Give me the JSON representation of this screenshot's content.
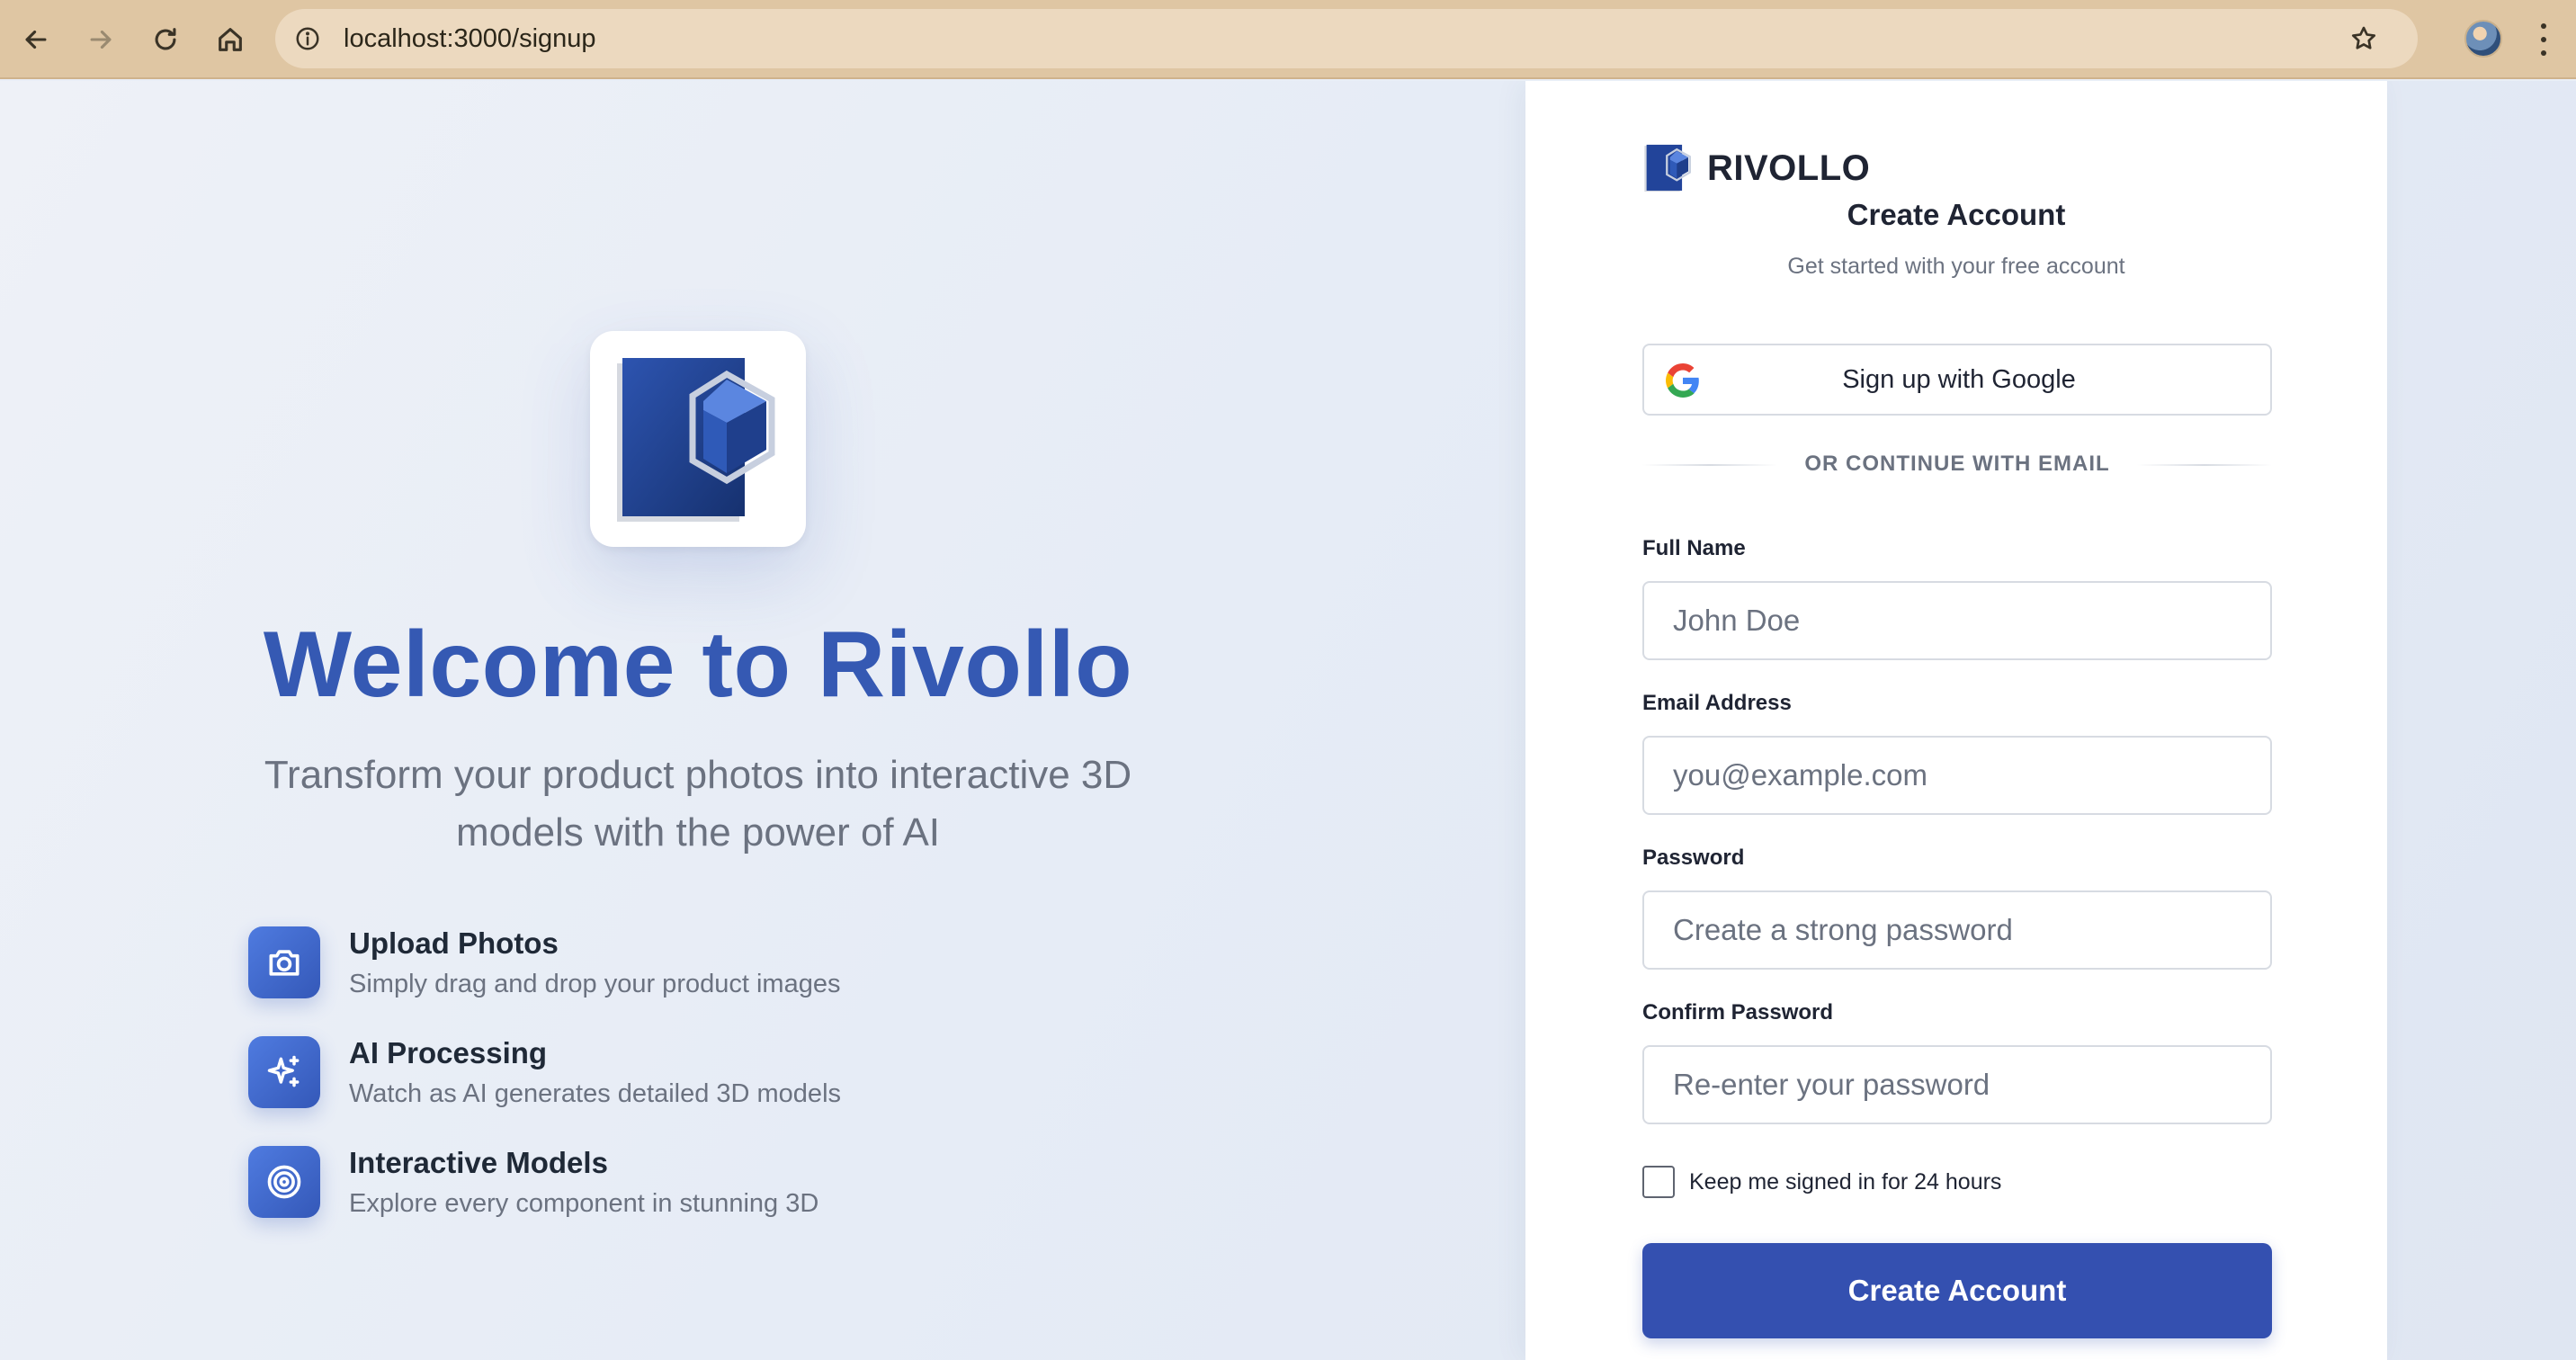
{
  "browser": {
    "url": "localhost:3000/signup",
    "icons": [
      "back-arrow-icon",
      "forward-arrow-icon",
      "reload-icon",
      "home-icon",
      "site-info-icon",
      "bookmark-star-icon",
      "kebab-menu-icon"
    ]
  },
  "hero": {
    "title": "Welcome to Rivollo",
    "subtitle": "Transform your product photos into interactive 3D models with the power of AI",
    "features": [
      {
        "icon": "camera-icon",
        "title": "Upload Photos",
        "description": "Simply drag and drop your product images"
      },
      {
        "icon": "sparkles-icon",
        "title": "AI Processing",
        "description": "Watch as AI generates detailed 3D models"
      },
      {
        "icon": "target-icon",
        "title": "Interactive Models",
        "description": "Explore every component in stunning 3D"
      }
    ]
  },
  "signup": {
    "brand_name": "RIVOLLO",
    "title": "Create Account",
    "subtitle": "Get started with your free account",
    "google_button": "Sign up with Google",
    "divider_text": "OR CONTINUE WITH EMAIL",
    "fields": [
      {
        "label": "Full Name",
        "placeholder": "John Doe",
        "value": ""
      },
      {
        "label": "Email Address",
        "placeholder": "you@example.com",
        "value": ""
      },
      {
        "label": "Password",
        "placeholder": "Create a strong password",
        "value": ""
      },
      {
        "label": "Confirm Password",
        "placeholder": "Re-enter your password",
        "value": ""
      }
    ],
    "remember_label": "Keep me signed in for 24 hours",
    "remember_checked": false,
    "submit_button": "Create Account"
  },
  "colors": {
    "accent": "#3450b0",
    "hero_title": "#3559b3",
    "chrome": "#dfc6a3"
  }
}
